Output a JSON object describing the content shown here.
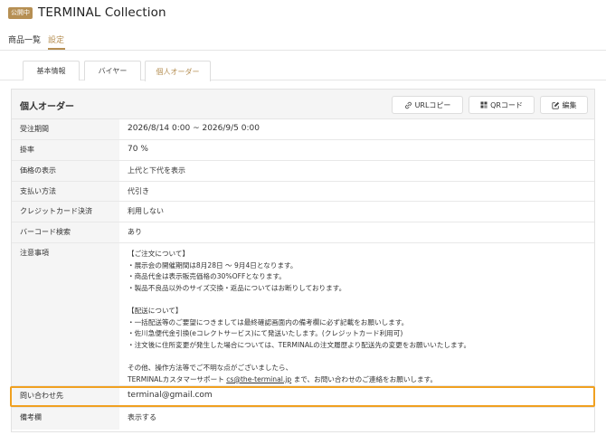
{
  "header": {
    "badge": "公開中",
    "title": "TERMINAL Collection"
  },
  "nav": {
    "items": [
      "商品一覧",
      "設定"
    ],
    "active": "設定"
  },
  "subtabs": [
    "基本情報",
    "バイヤー",
    "個人オーダー"
  ],
  "subtab_active": "個人オーダー",
  "panel": {
    "title": "個人オーダー",
    "buttons": {
      "url_copy": "URLコピー",
      "qr_code": "QRコード",
      "edit": "編集"
    }
  },
  "rows": [
    {
      "label": "受注期間",
      "value": "2026/8/14 0:00 ~ 2026/9/5 0:00"
    },
    {
      "label": "掛率",
      "value": "70 %"
    },
    {
      "label": "価格の表示",
      "value": "上代と下代を表示"
    },
    {
      "label": "支払い方法",
      "value": "代引き"
    },
    {
      "label": "クレジットカード決済",
      "value": "利用しない"
    },
    {
      "label": "バーコード検索",
      "value": "あり"
    }
  ],
  "notes": {
    "label": "注意事項",
    "lines": [
      "【ご注文について】",
      "・展示会の開催期間は8月28日 〜 9月4日となります。",
      "・商品代金は表示販売価格の30%OFFとなります。",
      "・製品不良品以外のサイズ交換・返品についてはお断りしております。",
      "",
      "【配送について】",
      "・一括配送等のご要望につきましては最終確認画面内の備考欄に必ず記載をお願いします。",
      "・佐川急便代金引換(eコレクトサービス)にて発送いたします。(クレジットカード利用可)",
      "・注文後に住所変更が発生した場合については、TERMINALの注文履歴より配送先の変更をお願いいたします。",
      "",
      "その他、操作方法等でご不明な点がございましたら、"
    ],
    "last_line_prefix": "TERMINALカスタマーサポート ",
    "last_line_email": "cs@the-terminal.jp",
    "last_line_suffix": " まで、お問い合わせのご連絡をお願いします。"
  },
  "contact": {
    "label": "問い合わせ先",
    "value": "terminal@gmail.com"
  },
  "remarks": {
    "label": "備考欄",
    "value": "表示する"
  },
  "colors": {
    "accent": "#b68f53",
    "highlight": "#f0a020"
  },
  "icons": {
    "url_copy": "link-icon",
    "qr_code": "qr-code-icon",
    "edit": "edit-icon"
  }
}
